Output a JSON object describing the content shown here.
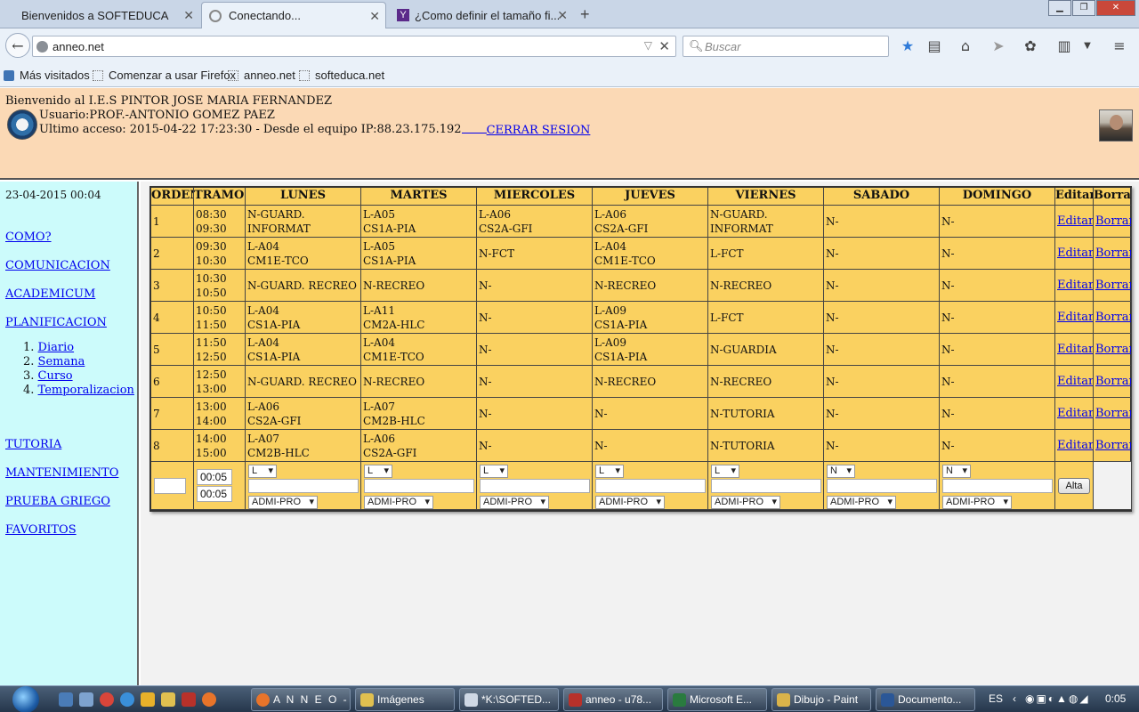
{
  "browser": {
    "tabs": [
      {
        "title": "Bienvenidos a SOFTEDUCA"
      },
      {
        "title": "Conectando..."
      },
      {
        "title": "¿Como definir el tamaño fi..."
      }
    ],
    "url": "anneo.net",
    "search_placeholder": "Buscar",
    "bookmarks": [
      "Más visitados",
      "Comenzar a usar Firefox",
      "anneo.net",
      "softeduca.net"
    ]
  },
  "header": {
    "welcome": "Bienvenido al I.E.S PINTOR JOSE MARIA FERNANDEZ",
    "user": "Usuario:PROF.-ANTONIO GOMEZ PAEZ",
    "last_access": "Ultimo acceso: 2015-04-22 17:23:30 - Desde el equipo IP:88.23.175.192",
    "logout": "CERRAR SESION"
  },
  "sidebar": {
    "date": "23-04-2015 00:04",
    "links": [
      "COMO?",
      "COMUNICACION",
      "ACADEMICUM",
      "PLANIFICACION"
    ],
    "sub": [
      "Diario",
      "Semana",
      "Curso",
      "Temporalizacion"
    ],
    "sub_numbers": [
      "1.",
      "2.",
      "3.",
      "4."
    ],
    "links2": [
      "TUTORIA",
      "MANTENIMIENTO",
      "PRUEBA GRIEGO",
      "FAVORITOS"
    ]
  },
  "table": {
    "headers": [
      "ORDEN",
      "TRAMOS",
      "LUNES",
      "MARTES",
      "MIERCOLES",
      "JUEVES",
      "VIERNES",
      "SABADO",
      "DOMINGO",
      "Editar",
      "Borrar"
    ],
    "rows": [
      {
        "orden": "1",
        "t1": "08:30",
        "t2": "09:30",
        "days": [
          [
            "N-GUARD.",
            "INFORMAT"
          ],
          [
            "L-A05",
            "CS1A-PIA"
          ],
          [
            "L-A06",
            "CS2A-GFI"
          ],
          [
            "L-A06",
            "CS2A-GFI"
          ],
          [
            "N-GUARD.",
            "INFORMAT"
          ],
          [
            "N-"
          ],
          [
            "N-"
          ]
        ]
      },
      {
        "orden": "2",
        "t1": "09:30",
        "t2": "10:30",
        "days": [
          [
            "L-A04",
            "CM1E-TCO"
          ],
          [
            "L-A05",
            "CS1A-PIA"
          ],
          [
            "N-FCT"
          ],
          [
            "L-A04",
            "CM1E-TCO"
          ],
          [
            "L-FCT"
          ],
          [
            "N-"
          ],
          [
            "N-"
          ]
        ]
      },
      {
        "orden": "3",
        "t1": "10:30",
        "t2": "10:50",
        "days": [
          [
            "N-GUARD. RECREO"
          ],
          [
            "N-RECREO"
          ],
          [
            "N-"
          ],
          [
            "N-RECREO"
          ],
          [
            "N-RECREO"
          ],
          [
            "N-"
          ],
          [
            "N-"
          ]
        ]
      },
      {
        "orden": "4",
        "t1": "10:50",
        "t2": "11:50",
        "days": [
          [
            "L-A04",
            "CS1A-PIA"
          ],
          [
            "L-A11",
            "CM2A-HLC"
          ],
          [
            "N-"
          ],
          [
            "L-A09",
            "CS1A-PIA"
          ],
          [
            "L-FCT"
          ],
          [
            "N-"
          ],
          [
            "N-"
          ]
        ]
      },
      {
        "orden": "5",
        "t1": "11:50",
        "t2": "12:50",
        "days": [
          [
            "L-A04",
            "CS1A-PIA"
          ],
          [
            "L-A04",
            "CM1E-TCO"
          ],
          [
            "N-"
          ],
          [
            "L-A09",
            "CS1A-PIA"
          ],
          [
            "N-GUARDIA"
          ],
          [
            "N-"
          ],
          [
            "N-"
          ]
        ]
      },
      {
        "orden": "6",
        "t1": "12:50",
        "t2": "13:00",
        "days": [
          [
            "N-GUARD. RECREO"
          ],
          [
            "N-RECREO"
          ],
          [
            "N-"
          ],
          [
            "N-RECREO"
          ],
          [
            "N-RECREO"
          ],
          [
            "N-"
          ],
          [
            "N-"
          ]
        ]
      },
      {
        "orden": "7",
        "t1": "13:00",
        "t2": "14:00",
        "days": [
          [
            "L-A06",
            "CS2A-GFI"
          ],
          [
            "L-A07",
            "CM2B-HLC"
          ],
          [
            "N-"
          ],
          [
            "N-"
          ],
          [
            "N-TUTORIA"
          ],
          [
            "N-"
          ],
          [
            "N-"
          ]
        ]
      },
      {
        "orden": "8",
        "t1": "14:00",
        "t2": "15:00",
        "days": [
          [
            "L-A07",
            "CM2B-HLC"
          ],
          [
            "L-A06",
            "CS2A-GFI"
          ],
          [
            "N-"
          ],
          [
            "N-"
          ],
          [
            "N-TUTORIA"
          ],
          [
            "N-"
          ],
          [
            "N-"
          ]
        ]
      }
    ],
    "edit_label": "Editar?",
    "delete_label": "Borrar?",
    "form": {
      "time1": "00:05",
      "time2": "00:05",
      "day_type": [
        "L",
        "L",
        "L",
        "L",
        "L",
        "N",
        "N"
      ],
      "prof": "ADMI-PRO",
      "add_label": "Alta"
    }
  },
  "taskbar": {
    "items": [
      "A N N E O - ...",
      "Imágenes",
      "*K:\\SOFTED...",
      "anneo - u78...",
      "Microsoft E...",
      "Dibujo - Paint",
      "Documento..."
    ],
    "lang": "ES",
    "time": "0:05"
  }
}
